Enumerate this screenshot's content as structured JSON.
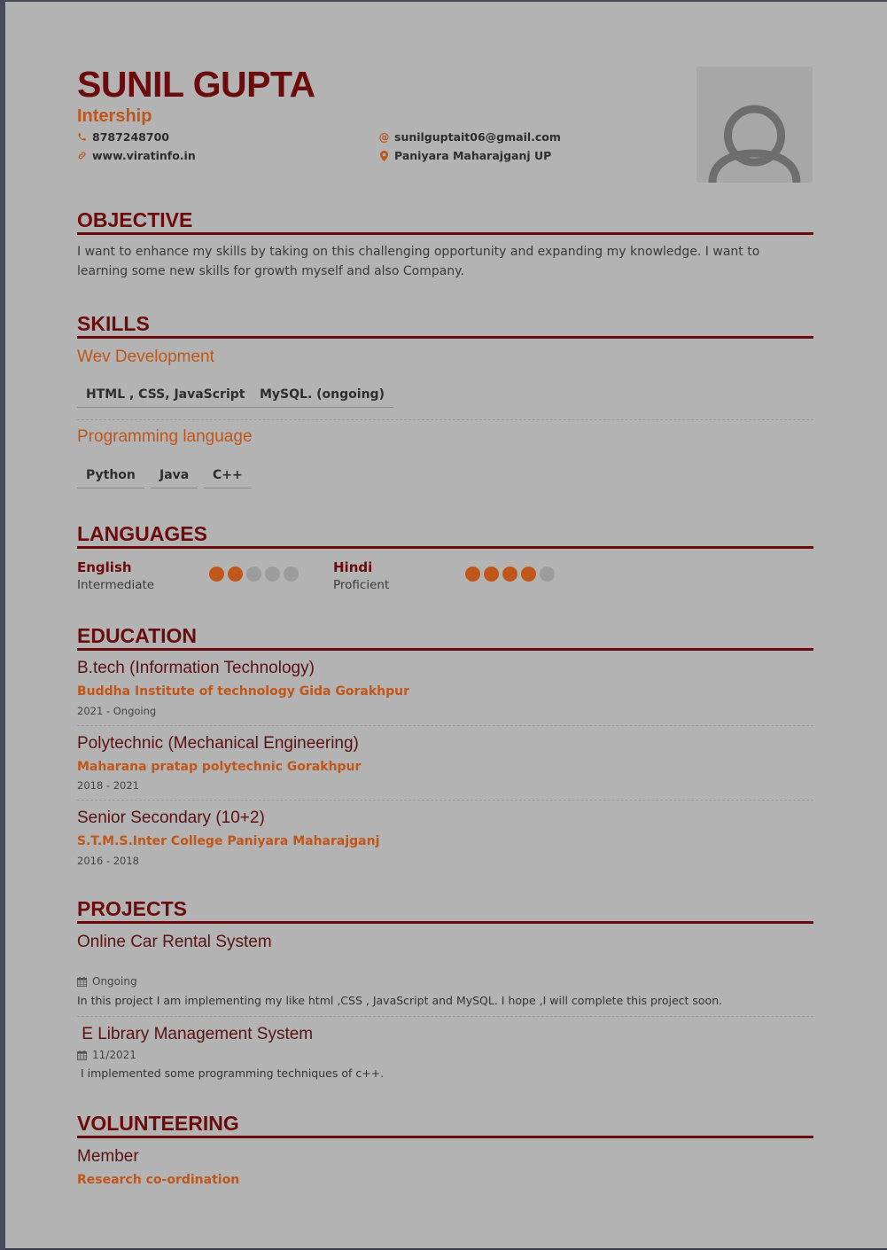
{
  "header": {
    "name": "SUNIL GUPTA",
    "title": "Intership",
    "phone": "8787248700",
    "website": "www.viratinfo.in",
    "email": "sunilguptait06@gmail.com",
    "location": "Paniyara Maharajganj UP",
    "icons": {
      "phone": "phone-icon",
      "website": "link-icon",
      "email": "at-icon",
      "location": "location-pin-icon",
      "photo": "user-avatar-icon"
    }
  },
  "objective": {
    "heading": "OBJECTIVE",
    "text": "I want to enhance my skills by taking on this challenging opportunity and expanding my knowledge. I want to learning some new skills for growth myself and also Company."
  },
  "skills": {
    "heading": "SKILLS",
    "groups": [
      {
        "name": "Wev Development",
        "items": [
          "HTML , CSS, JavaScript",
          "MySQL. (ongoing)"
        ]
      },
      {
        "name": "Programming language",
        "items": [
          "Python",
          "Java",
          "C++"
        ]
      }
    ]
  },
  "languages": {
    "heading": "LANGUAGES",
    "items": [
      {
        "name": "English",
        "level": "Intermediate",
        "rating": 2,
        "max": 5
      },
      {
        "name": "Hindi",
        "level": "Proficient",
        "rating": 4,
        "max": 5
      }
    ]
  },
  "education": {
    "heading": "EDUCATION",
    "items": [
      {
        "degree": "B.tech (Information Technology)",
        "school": "Buddha Institute of technology Gida Gorakhpur",
        "years": "2021 - Ongoing"
      },
      {
        "degree": "Polytechnic (Mechanical Engineering)",
        "school": "Maharana pratap polytechnic Gorakhpur",
        "years": "2018 - 2021"
      },
      {
        "degree": "Senior Secondary (10+2)",
        "school": "S.T.M.S.Inter College Paniyara Maharajganj",
        "years": "2016 - 2018"
      }
    ]
  },
  "projects": {
    "heading": "PROJECTS",
    "items": [
      {
        "title": "Online Car Rental System",
        "date": "Ongoing",
        "description": "In this project I am implementing my like html ,CSS , JavaScript and MySQL. I hope ,I will complete this project soon."
      },
      {
        "title": " E Library Management System",
        "date": "11/2021",
        "description": " I implemented some programming techniques of c++."
      }
    ]
  },
  "volunteering": {
    "heading": "VOLUNTEERING",
    "role": "Member",
    "organization": "Research co-ordination"
  },
  "colors": {
    "primary": "#6b0b0b",
    "accent": "#c0561a",
    "background": "#b3b3b3"
  }
}
